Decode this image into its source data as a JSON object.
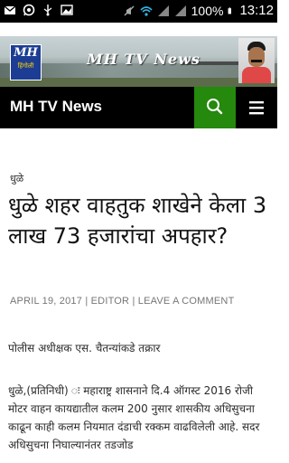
{
  "status_bar": {
    "battery": "100%",
    "time": "13:12"
  },
  "banner": {
    "logo_text": "MH",
    "logo_subtext": "हिंगोली",
    "title": "MH TV News"
  },
  "header": {
    "site_name": "MH TV News"
  },
  "article": {
    "category": "धुळे",
    "title": "धुळे शहर वाहतुक शाखेने केला 3 लाख 73 हजारांचा अपहार?",
    "date": "APRIL 19, 2017",
    "author": "EDITOR",
    "comment_link": "LEAVE A COMMENT",
    "separator": " | ",
    "subhead": "पोलीस अधीक्षक एस. चैतन्यांकडे तक्रार",
    "body": "धुळे,(प्रतिनिधी) ः महाराष्ट्र शासनाने दि.4 ऑगस्ट 2016 रोजी मोटर वाहन कायद्यातील कलम 200 नुसार शासकीय अधिसुचना काढून काही कलम नियमात दंडाची रक्कम वाढविलेली आहे. सदर अधिसुचना निघाल्यानंतर तडजोड"
  },
  "colors": {
    "navbar_bg": "#000000",
    "search_bg": "#24890d",
    "meta_text": "#767676"
  },
  "icons": [
    "mail-icon",
    "whatsapp-icon",
    "usb-icon",
    "image-icon",
    "mute-icon",
    "wifi-icon",
    "signal-icon",
    "battery-icon",
    "search-icon",
    "menu-icon"
  ]
}
